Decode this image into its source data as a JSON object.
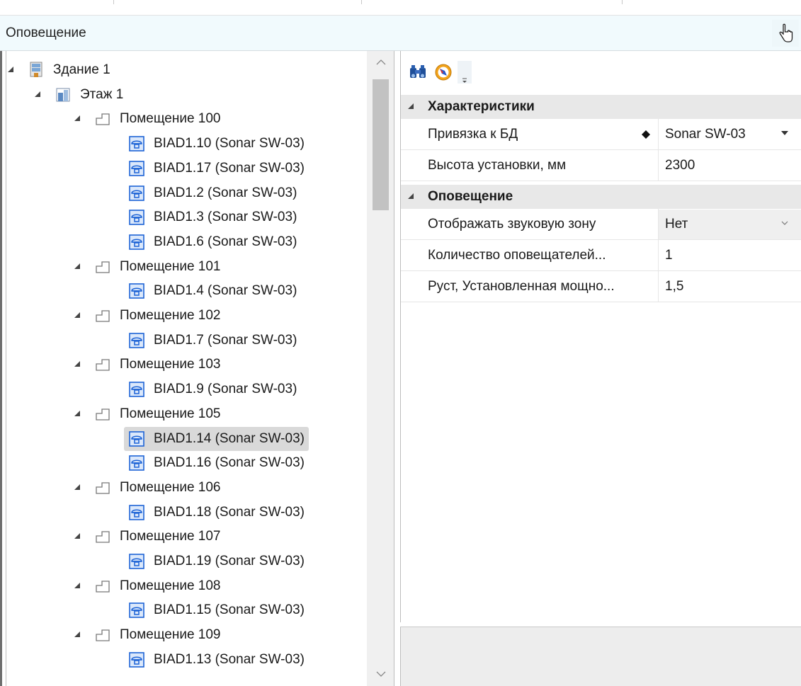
{
  "header": {
    "title": "Оповещение",
    "pointer_icon": "hand-pointer-icon"
  },
  "tree": {
    "rows": [
      {
        "label": "Здание 1",
        "icon": "building-icon",
        "level": 0,
        "expanded": true
      },
      {
        "label": "Этаж 1",
        "icon": "floor-icon",
        "level": 1,
        "expanded": true
      },
      {
        "label": "Помещение 100",
        "icon": "room-icon",
        "level": 2,
        "expanded": true
      },
      {
        "label": "BIAD1.10 (Sonar SW-03)",
        "icon": "speaker-device-icon",
        "level": 3
      },
      {
        "label": "BIAD1.17 (Sonar SW-03)",
        "icon": "speaker-device-icon",
        "level": 3
      },
      {
        "label": "BIAD1.2 (Sonar SW-03)",
        "icon": "speaker-device-icon",
        "level": 3
      },
      {
        "label": "BIAD1.3 (Sonar SW-03)",
        "icon": "speaker-device-icon",
        "level": 3
      },
      {
        "label": "BIAD1.6 (Sonar SW-03)",
        "icon": "speaker-device-icon",
        "level": 3
      },
      {
        "label": "Помещение 101",
        "icon": "room-icon",
        "level": 2,
        "expanded": true
      },
      {
        "label": "BIAD1.4 (Sonar SW-03)",
        "icon": "speaker-device-icon",
        "level": 3
      },
      {
        "label": "Помещение 102",
        "icon": "room-icon",
        "level": 2,
        "expanded": true
      },
      {
        "label": "BIAD1.7 (Sonar SW-03)",
        "icon": "speaker-device-icon",
        "level": 3
      },
      {
        "label": "Помещение 103",
        "icon": "room-icon",
        "level": 2,
        "expanded": true
      },
      {
        "label": "BIAD1.9 (Sonar SW-03)",
        "icon": "speaker-device-icon",
        "level": 3
      },
      {
        "label": "Помещение 105",
        "icon": "room-icon",
        "level": 2,
        "expanded": true
      },
      {
        "label": "BIAD1.14 (Sonar SW-03)",
        "icon": "speaker-device-icon",
        "level": 3,
        "selected": true
      },
      {
        "label": "BIAD1.16 (Sonar SW-03)",
        "icon": "speaker-device-icon",
        "level": 3
      },
      {
        "label": "Помещение 106",
        "icon": "room-icon",
        "level": 2,
        "expanded": true
      },
      {
        "label": "BIAD1.18 (Sonar SW-03)",
        "icon": "speaker-device-icon",
        "level": 3
      },
      {
        "label": "Помещение 107",
        "icon": "room-icon",
        "level": 2,
        "expanded": true
      },
      {
        "label": "BIAD1.19 (Sonar SW-03)",
        "icon": "speaker-device-icon",
        "level": 3
      },
      {
        "label": "Помещение 108",
        "icon": "room-icon",
        "level": 2,
        "expanded": true
      },
      {
        "label": "BIAD1.15 (Sonar SW-03)",
        "icon": "speaker-device-icon",
        "level": 3
      },
      {
        "label": "Помещение 109",
        "icon": "room-icon",
        "level": 2,
        "expanded": true
      },
      {
        "label": "BIAD1.13 (Sonar SW-03)",
        "icon": "speaker-device-icon",
        "level": 3
      }
    ]
  },
  "properties": {
    "toolbar": [
      "binoculars-icon",
      "compass-icon",
      "more-icon"
    ],
    "categories": [
      {
        "label": "Характеристики",
        "rows": [
          {
            "name": "Привязка к БД",
            "value": "Sonar SW-03",
            "db_mark": true,
            "control": "dropdown"
          },
          {
            "name": "Высота установки, мм",
            "value": "2300"
          }
        ]
      },
      {
        "label": "Оповещение",
        "rows": [
          {
            "name": "Отображать звуковую зону",
            "value": "Нет",
            "control": "combo"
          },
          {
            "name": "Количество оповещателей...",
            "value": "1"
          },
          {
            "name": "Руст, Установленная мощно...",
            "value": "1,5"
          }
        ]
      }
    ]
  },
  "colors": {
    "header_bg": "#f1fafd",
    "selection": "#d9d9d9",
    "category_bg": "#e8e8e8",
    "device_icon": "#1d63d6"
  }
}
